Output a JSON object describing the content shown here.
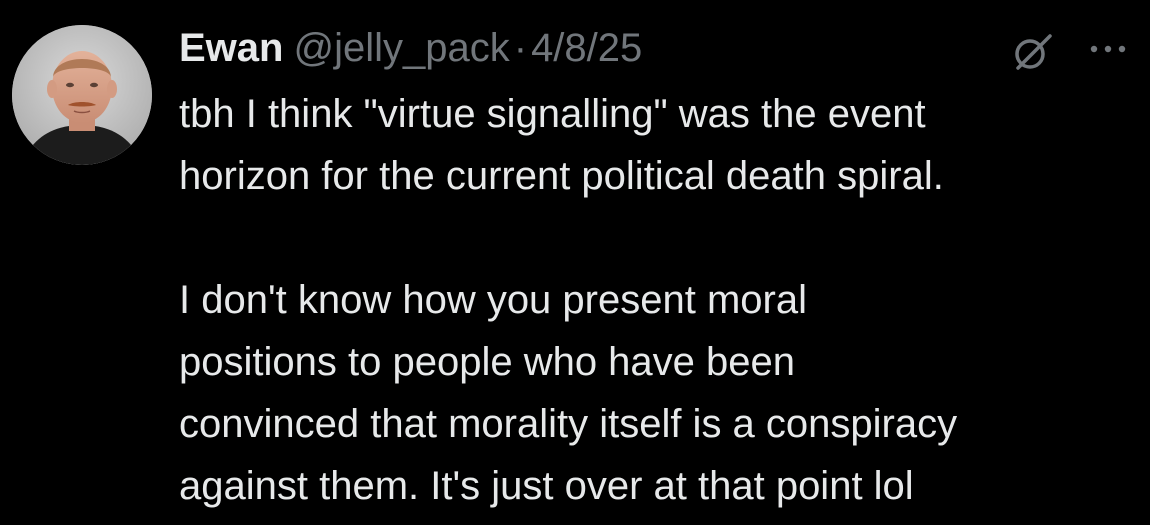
{
  "tweet": {
    "author": {
      "name": "Ewan",
      "handle": "@jelly_pack",
      "avatar_icon": "profile-photo-icon"
    },
    "separator": "·",
    "date": "4/8/25",
    "actions": {
      "grok_icon": "grok-icon",
      "more_icon": "more-dots-icon"
    },
    "text": {
      "paragraph_1": "tbh I think \"virtue signalling\" was the event\nhorizon for the current political death spiral.",
      "paragraph_2": "I don't know how you present moral\npositions to people who have been\nconvinced that morality itself is a conspiracy\nagainst them. It's just over at that point lol"
    }
  },
  "colors": {
    "background": "#000000",
    "primary_text": "#e7e9ea",
    "secondary_text": "#71767b"
  }
}
